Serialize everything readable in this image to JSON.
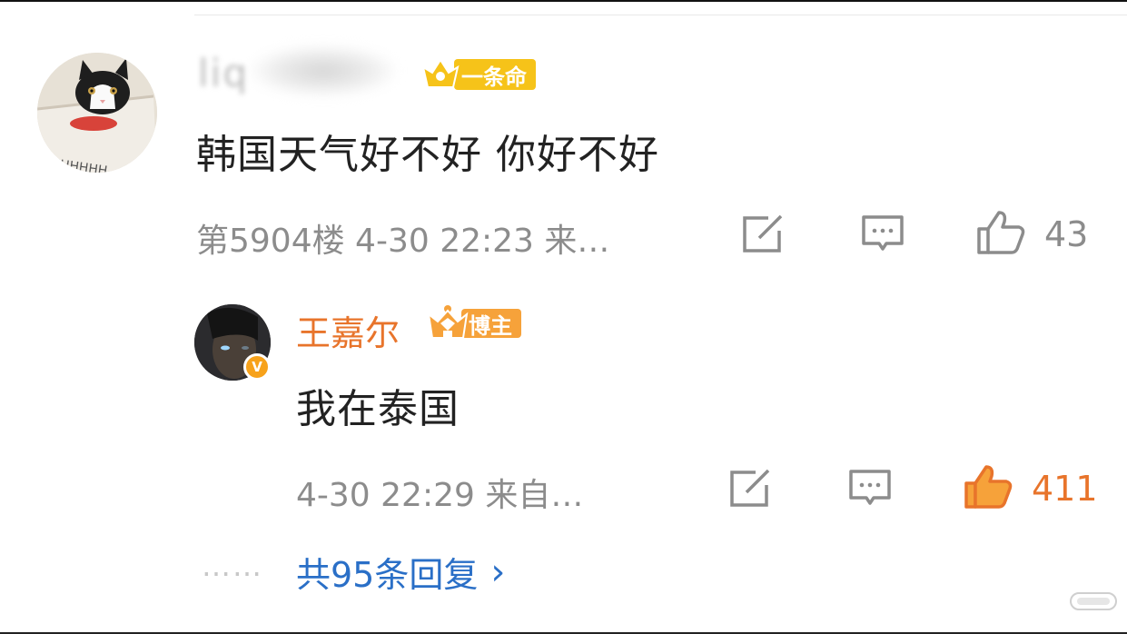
{
  "comment": {
    "username_blurred": "liq",
    "fan_badge": {
      "label": "一条命",
      "icon": "fan-level-icon",
      "color": "#f6c319"
    },
    "text": "韩国天气好不好 你好不好",
    "meta": "第5904楼 4-30 22:23 来…",
    "like_count": "43",
    "avatar_print": "HHHHHH"
  },
  "reply": {
    "username": "王嘉尔",
    "blogger_badge": {
      "label": "博主",
      "icon": "crown-icon",
      "color": "#f6a23a"
    },
    "verified_badge": "V",
    "text": "我在泰国",
    "meta": "4-30 22:29 来自…",
    "like_count": "411",
    "liked": true
  },
  "more_replies": {
    "dots": "……",
    "label": "共95条回复",
    "chevron": "›"
  },
  "colors": {
    "accent_orange": "#e8742b",
    "link_blue": "#2a6fc7",
    "meta_gray": "#8c8c8c"
  }
}
